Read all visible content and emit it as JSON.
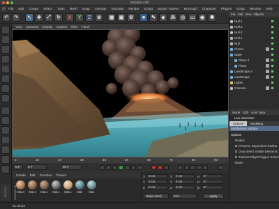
{
  "window": {
    "title": "volcano.c4d"
  },
  "menubar": [
    "File",
    "Edit",
    "Create",
    "Select",
    "Tools",
    "Mesh",
    "Snap",
    "Animate",
    "Simulate",
    "Render",
    "Sculpt",
    "Motion Tracker",
    "MoGraph",
    "Character",
    "Plugins",
    "Script",
    "Window",
    "Help"
  ],
  "toolbar": {
    "axis_x": "X",
    "axis_y": "Y",
    "axis_z": "Z"
  },
  "viewport": {
    "menu": [
      "View",
      "Cameras",
      "Display",
      "Options",
      "Filter",
      "Panel"
    ]
  },
  "timeline": {
    "ticks": [
      "0",
      "10",
      "20",
      "30",
      "40",
      "50",
      "60",
      "70",
      "80",
      "90"
    ],
    "current_frame": "0 F",
    "start_field": "0 F",
    "end_field": "90 F",
    "min_field": "0 F"
  },
  "material_manager": {
    "menu": [
      "Create",
      "Edit",
      "Function",
      "Texture"
    ],
    "materials": [
      {
        "label": "Mat.3",
        "color": "#b07a55"
      },
      {
        "label": "Mat.1",
        "color": "#8b6a4c"
      },
      {
        "label": "Mat.1",
        "color": "#7d6550"
      },
      {
        "label": "Mat.1",
        "color": "#6d6d6d"
      },
      {
        "label": "Mat.1",
        "color": "#c9a57d"
      },
      {
        "label": "Mat.",
        "color": "#5a7f86"
      },
      {
        "label": "Mat.",
        "color": "#6c8f95"
      }
    ]
  },
  "coordinates": {
    "rows": [
      {
        "axis": "X",
        "value": "0 cm",
        "axis2": "X",
        "value2": "0 cm",
        "axis3": "H",
        "value3": "0 °"
      },
      {
        "axis": "Y",
        "value": "0 cm",
        "axis2": "Y",
        "value2": "0 cm",
        "axis3": "P",
        "value3": "0 °"
      },
      {
        "axis": "Z",
        "value": "0 cm",
        "axis2": "Z",
        "value2": "0 cm",
        "axis3": "B",
        "value3": "0 °"
      }
    ],
    "mode_dropdown": "Object (Rel)",
    "size_dropdown": "Size",
    "apply_label": "Apply"
  },
  "object_manager": {
    "tabs": [
      "File",
      "Edit",
      "View",
      "Objects"
    ],
    "objects": [
      {
        "name": "Null.4",
        "color": "#bbbbbb"
      },
      {
        "name": "Null.3",
        "color": "#bbbbbb"
      },
      {
        "name": "Null.2",
        "color": "#bbbbbb"
      },
      {
        "name": "Null.1",
        "color": "#bbbbbb"
      },
      {
        "name": "Null",
        "color": "#bbbbbb"
      },
      {
        "name": "Cloner",
        "color": "#6fb0e0"
      },
      {
        "name": "water",
        "color": "#6fb0e0"
      },
      {
        "name": "Plane.2",
        "color": "#6fb0e0"
      },
      {
        "name": "Plane",
        "color": "#6fb0e0"
      },
      {
        "name": "Landscape.2",
        "color": "#6fb0e0"
      },
      {
        "name": "Landscape",
        "color": "#6fb0e0"
      },
      {
        "name": "Lights",
        "color": "#e0c46f"
      },
      {
        "name": "Camera",
        "color": "#bbbbbb"
      }
    ]
  },
  "attributes": {
    "tabs": [
      "Mode",
      "Edit",
      "User Data"
    ],
    "title": "Live Selection",
    "subtabs": [
      "Options",
      "Modeling"
    ],
    "section": "Subdivision Surface",
    "group": "Options",
    "lines": [
      "Radius",
      "Preserve Dependent Radius",
      "Only Select Visible Elements",
      "Tolerant Edge/Polygon Select",
      "Mode"
    ]
  },
  "status": {
    "time": "01:46:23"
  },
  "branding": {
    "maxon": "MAXON CINEMA 4D"
  }
}
